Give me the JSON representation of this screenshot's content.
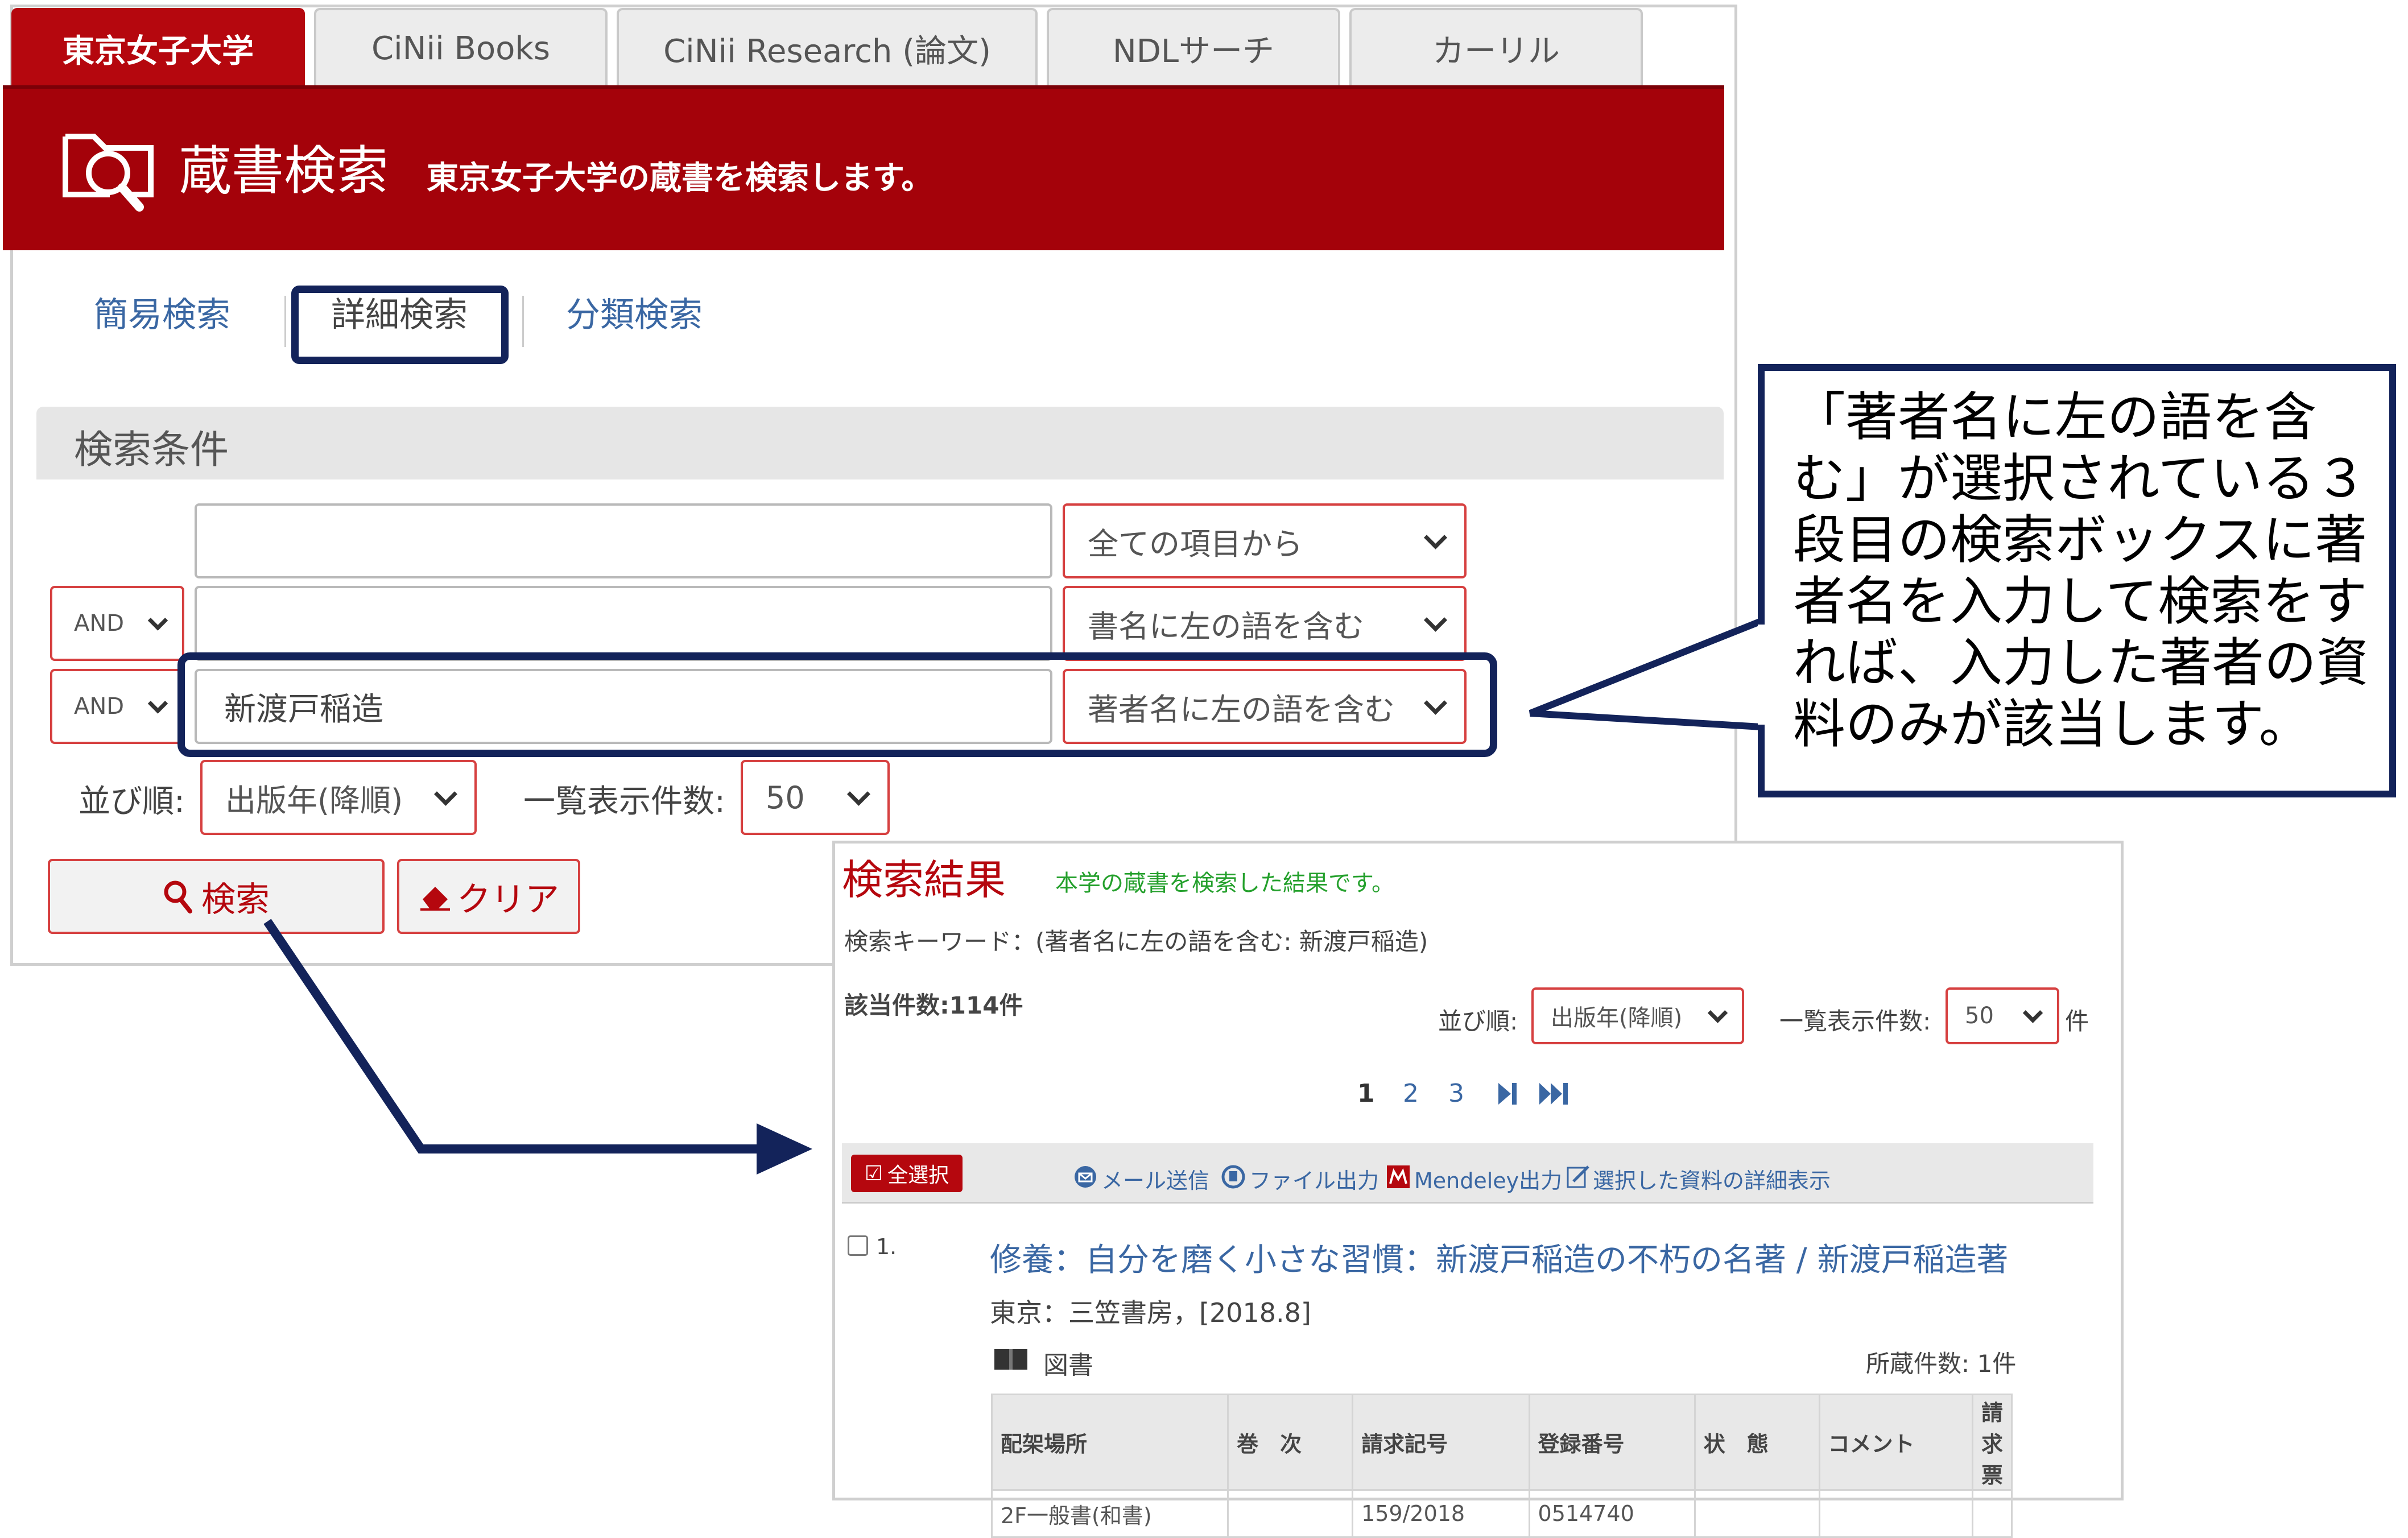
{
  "tabs": [
    {
      "label": "東京女子大学"
    },
    {
      "label": "CiNii Books"
    },
    {
      "label": "CiNii Research (論文)"
    },
    {
      "label": "NDLサーチ"
    },
    {
      "label": "カーリル"
    }
  ],
  "banner": {
    "title": "蔵書検索",
    "description": "東京女子大学の蔵書を検索します。"
  },
  "search_modes": {
    "simple": "簡易検索",
    "detail": "詳細検索",
    "classification": "分類検索"
  },
  "conditions_title": "検索条件",
  "rows": [
    {
      "operator": "",
      "value": "",
      "field": "全ての項目から"
    },
    {
      "operator": "AND",
      "value": "",
      "field": "書名に左の語を含む"
    },
    {
      "operator": "AND",
      "value": "新渡戸稲造",
      "field": "著者名に左の語を含む"
    }
  ],
  "sort": {
    "label": "並び順:",
    "value": "出版年(降順)"
  },
  "per_page": {
    "label": "一覧表示件数:",
    "value": "50"
  },
  "buttons": {
    "search": "検索",
    "clear": "クリア"
  },
  "callout": "「著者名に左の語を含む」が選択されている３段目の検索ボックスに著者名を入力して検索をすれば、入力した著者の資料のみが該当します。",
  "results": {
    "title": "検索結果",
    "description": "本学の蔵書を検索した結果です。",
    "keyword": "検索キーワード：(著者名に左の語を含む: 新渡戸稲造)",
    "count": "該当件数:114件",
    "sort_label": "並び順:",
    "sort_value": "出版年(降順)",
    "per_page_label": "一覧表示件数:",
    "per_page_value": "50",
    "per_page_unit": "件",
    "pages": [
      "1",
      "2",
      "3"
    ],
    "toolbar": {
      "select_all": "全選択",
      "mail": "メール送信",
      "file": "ファイル出力",
      "mendeley": "Mendeley出力",
      "detail": "選択した資料の詳細表示"
    },
    "item": {
      "number": "1.",
      "title": "修養：自分を磨く小さな習慣：新渡戸稲造の不朽の名著 / 新渡戸稲造著",
      "publisher": "東京：三笠書房，[2018.8]",
      "type": "図書",
      "holdings_count": "所蔵件数: 1件"
    },
    "holdings": {
      "headers": [
        "配架場所",
        "巻　次",
        "請求記号",
        "登録番号",
        "状　態",
        "コメント",
        "請求票"
      ],
      "rows": [
        [
          "2F一般書(和書)",
          "",
          "159/2018",
          "0514740",
          "",
          "",
          ""
        ]
      ]
    }
  },
  "colors": {
    "brand": "#a4020a",
    "highlight": "#13235a",
    "link": "#3a67a3"
  }
}
